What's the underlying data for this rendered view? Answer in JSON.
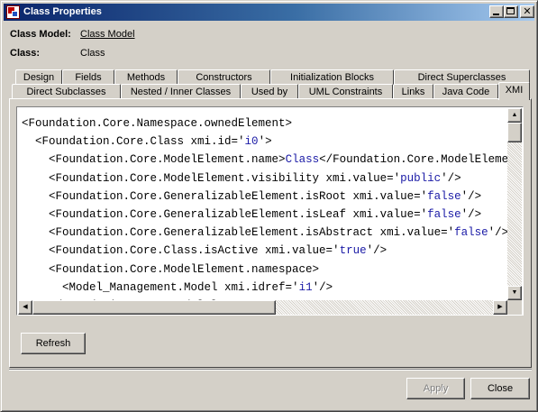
{
  "window": {
    "title": "Class Properties",
    "min_glyph": "_",
    "max_glyph": "□",
    "close_glyph": "✕"
  },
  "info": {
    "model_label": "Class Model:",
    "model_value": "Class Model",
    "class_label": "Class:",
    "class_value": "Class"
  },
  "tabs_row1": [
    "Design",
    "Fields",
    "Methods",
    "Constructors",
    "Initialization Blocks",
    "Direct Superclasses"
  ],
  "tabs_row2": [
    "Direct Subclasses",
    "Nested / Inner Classes",
    "Used by",
    "UML Constraints",
    "Links",
    "Java Code",
    "XMI"
  ],
  "active_tab": "XMI",
  "code": [
    [
      {
        "t": "tag",
        "s": "<Foundation.Core.Namespace.ownedElement>"
      }
    ],
    [
      {
        "t": "tag",
        "s": "  <Foundation.Core.Class xmi.id='"
      },
      {
        "t": "val",
        "s": "i0"
      },
      {
        "t": "tag",
        "s": "'>"
      }
    ],
    [
      {
        "t": "tag",
        "s": "    <Foundation.Core.ModelElement.name>"
      },
      {
        "t": "tx",
        "s": "Class"
      },
      {
        "t": "tag",
        "s": "</Foundation.Core.ModelElement.name>"
      }
    ],
    [
      {
        "t": "tag",
        "s": "    <Foundation.Core.ModelElement.visibility xmi.value='"
      },
      {
        "t": "val",
        "s": "public"
      },
      {
        "t": "tag",
        "s": "'/>"
      }
    ],
    [
      {
        "t": "tag",
        "s": "    <Foundation.Core.GeneralizableElement.isRoot xmi.value='"
      },
      {
        "t": "val",
        "s": "false"
      },
      {
        "t": "tag",
        "s": "'/>"
      }
    ],
    [
      {
        "t": "tag",
        "s": "    <Foundation.Core.GeneralizableElement.isLeaf xmi.value='"
      },
      {
        "t": "val",
        "s": "false"
      },
      {
        "t": "tag",
        "s": "'/>"
      }
    ],
    [
      {
        "t": "tag",
        "s": "    <Foundation.Core.GeneralizableElement.isAbstract xmi.value='"
      },
      {
        "t": "val",
        "s": "false"
      },
      {
        "t": "tag",
        "s": "'/>"
      }
    ],
    [
      {
        "t": "tag",
        "s": "    <Foundation.Core.Class.isActive xmi.value='"
      },
      {
        "t": "val",
        "s": "true"
      },
      {
        "t": "tag",
        "s": "'/>"
      }
    ],
    [
      {
        "t": "tag",
        "s": "    <Foundation.Core.ModelElement.namespace>"
      }
    ],
    [
      {
        "t": "tag",
        "s": "      <Model_Management.Model xmi.idref='"
      },
      {
        "t": "val",
        "s": "i1"
      },
      {
        "t": "tag",
        "s": "'/>"
      }
    ],
    [
      {
        "t": "tag",
        "s": "    </Foundation.Core.ModelElement.namespace>"
      }
    ]
  ],
  "buttons": {
    "refresh": "Refresh",
    "apply": "Apply",
    "close": "Close"
  },
  "scroll": {
    "up": "▲",
    "down": "▼",
    "left": "◀",
    "right": "▶"
  }
}
